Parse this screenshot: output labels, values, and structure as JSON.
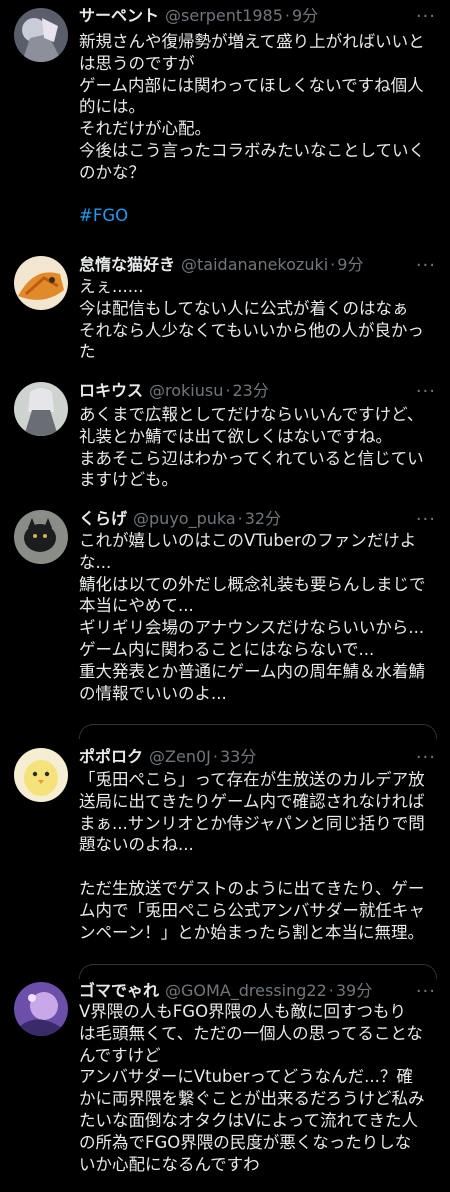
{
  "tweets": [
    {
      "name": "サーペント",
      "handle": "@serpent1985",
      "time": "9分",
      "lines": [
        "新規さんや復帰勢が増えて盛り上がればいいと",
        "は思うのですが",
        "ゲーム内部には関わってほしくないですね個人",
        "的には。",
        "それだけが心配。",
        "今後はこう言ったコラボみたいなことしていく",
        "のかな？"
      ],
      "hashtag": "#FGO"
    },
    {
      "name": "怠惰な猫好き",
      "handle": "@taidananekozuki",
      "time": "9分",
      "lines": [
        "えぇ......",
        "今は配信もしてない人に公式が着くのはなぁ",
        "それなら人少なくてもいいから他の人が良かっ",
        "た"
      ]
    },
    {
      "name": "ロキウス",
      "handle": "@rokiusu",
      "time": "23分",
      "lines": [
        "あくまで広報としてだけならいいんですけど、",
        "礼装とか鯖では出て欲しくはないですね。",
        "まあそこら辺はわかってくれていると信じてい",
        "ますけども。"
      ]
    },
    {
      "name": "くらげ",
      "handle": "@puyo_puka",
      "time": "32分",
      "lines": [
        "これが嬉しいのはこのVTuberのファンだけよ",
        "な...",
        "鯖化は以ての外だし概念礼装も要らんしまじで",
        "本当にやめて...",
        "ギリギリ会場のアナウンスだけならいいから...",
        "ゲーム内に関わることにはならないで...",
        "重大発表とか普通にゲーム内の周年鯖＆水着鯖",
        "の情報でいいのよ..."
      ]
    },
    {
      "name": "ポポロク",
      "handle": "@Zen0J",
      "time": "33分",
      "lines": [
        "「兎田ぺこら」って存在が生放送のカルデア放",
        "送局に出てきたりゲーム内で確認されなければ",
        "まぁ...サンリオとか侍ジャパンと同じ括りで問",
        "題ないのよね...",
        "",
        "ただ生放送でゲストのように出てきたり、ゲー",
        "ム内で「兎田ぺこら公式アンバサダー就任キャ",
        "ンペーン！」とか始まったら割と本当に無理。"
      ]
    },
    {
      "name": "ゴマでゃれ",
      "handle": "@GOMA_dressing22",
      "time": "39分",
      "lines": [
        "V界隈の人もFGO界隈の人も敵に回すつもり",
        "は毛頭無くて、ただの一個人の思ってることな",
        "んですけど",
        "アンバサダーにVtuberってどうなんだ...？確",
        "かに両界隈を繋ぐことが出来るだろうけど私み",
        "たいな面倒なオタクはVによって流れてきた人",
        "の所為でFGO界隈の民度が悪くなったりしな",
        "いか心配になるんですわ"
      ]
    }
  ],
  "more_icon": "more-horizontal-icon",
  "colors": {
    "background": "#000000",
    "text": "#e7e9ea",
    "muted": "#71767b",
    "link": "#1d9bf0",
    "border": "#2f3336"
  }
}
